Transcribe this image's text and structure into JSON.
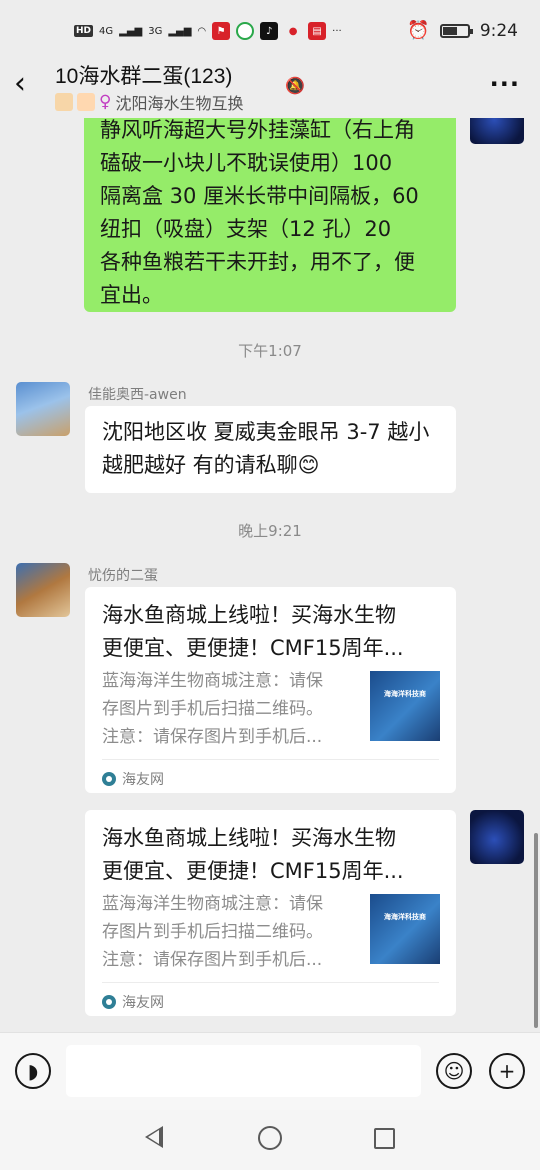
{
  "status_bar": {
    "hd": "HD",
    "net1": "4G",
    "net2": "3G",
    "time": "9:24",
    "more": "···",
    "battery_level": 0.6
  },
  "header": {
    "title": "10海水群二蛋(123)",
    "subtitle": "沈阳海水生物互换",
    "back_icon": "chevron-left-icon",
    "more_icon": "more-icon",
    "mute_icon": "bell-muted-icon"
  },
  "messages": {
    "m1": {
      "lines": [
        "静风听海超大号外挂藻缸（右上角",
        "磕破一小块儿不耽误使用）100",
        "隔离盒 30 厘米长带中间隔板，60",
        "纽扣（吸盘）支架（12 孔）20",
        "各种鱼粮若干未开封，用不了，便",
        "宜出。"
      ]
    },
    "t1": "下午1:07",
    "m2": {
      "sender": "佳能奥西-awen",
      "lines": [
        "沈阳地区收 夏威夷金眼吊 3-7 越小",
        "越肥越好 有的请私聊😊"
      ]
    },
    "t2": "晚上9:21",
    "m3": {
      "sender": "忧伤的二蛋",
      "title_lines": [
        "海水鱼商城上线啦！买海水生物",
        "更便宜、更便捷！CMF15周年..."
      ],
      "desc_lines": [
        "蓝海海洋生物商城注意：请保",
        "存图片到手机后扫描二维码。",
        "注意：请保存图片到手机后..."
      ],
      "thumb_text": "海海洋科技商",
      "source": "海友网"
    },
    "m4": {
      "title_lines": [
        "海水鱼商城上线啦！买海水生物",
        "更便宜、更便捷！CMF15周年..."
      ],
      "desc_lines": [
        "蓝海海洋生物商城注意：请保",
        "存图片到手机后扫描二维码。",
        "注意：请保存图片到手机后..."
      ],
      "thumb_text": "海海洋科技商",
      "source": "海友网"
    }
  },
  "input_bar": {
    "voice_icon": "voice-icon",
    "emoji_icon": "emoji-icon",
    "plus_icon": "plus-icon",
    "value": ""
  },
  "colors": {
    "bg": "#ededed",
    "self_bubble": "#95ec69",
    "other_bubble": "#ffffff"
  }
}
